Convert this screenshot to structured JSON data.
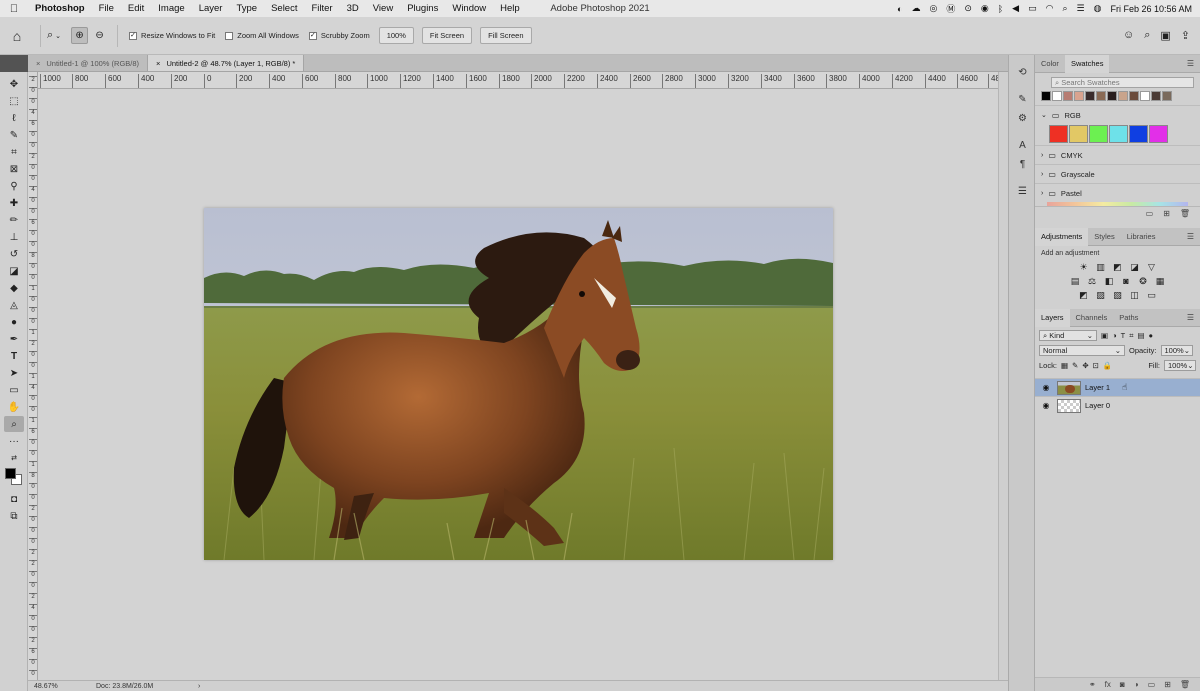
{
  "menubar": {
    "apple_icon": "apple-icon",
    "app": "Photoshop",
    "items": [
      "File",
      "Edit",
      "Image",
      "Layer",
      "Type",
      "Select",
      "Filter",
      "3D",
      "View",
      "Plugins",
      "Window",
      "Help"
    ],
    "window_title": "Adobe Photoshop 2021",
    "datetime": "Fri Feb 26  10:56 AM"
  },
  "options": {
    "resize_windows": "Resize Windows to Fit",
    "zoom_all": "Zoom All Windows",
    "scrubby": "Scrubby Zoom",
    "zoom_value": "100%",
    "fit_screen": "Fit Screen",
    "fill_screen": "Fill Screen"
  },
  "tabs": [
    {
      "label": "Untitled-1 @ 100% (RGB/8)",
      "close": "×"
    },
    {
      "label": "Untitled-2 @ 48.7% (Layer 1, RGB/8) *",
      "close": "×"
    }
  ],
  "ruler": {
    "top": [
      "1000",
      "800",
      "600",
      "400",
      "200",
      "0",
      "200",
      "400",
      "600",
      "800",
      "1000",
      "1200",
      "1400",
      "1600",
      "1800",
      "2000",
      "2200",
      "2400",
      "2600",
      "2800",
      "3000",
      "3200",
      "3400",
      "3600",
      "3800",
      "4000",
      "4200",
      "4400",
      "4600",
      "48"
    ],
    "left": [
      "2",
      "0",
      "0",
      "4",
      "6",
      "0",
      "0",
      "2",
      "0",
      "0",
      "4",
      "0",
      "0",
      "6",
      "0",
      "0",
      "8",
      "0",
      "0",
      "1",
      "0",
      "0",
      "0",
      "1",
      "2",
      "0",
      "0",
      "1",
      "4",
      "0",
      "0",
      "1",
      "6",
      "0",
      "0",
      "1",
      "8",
      "0",
      "0",
      "2",
      "0",
      "0",
      "0",
      "2",
      "2",
      "0",
      "0",
      "2",
      "4",
      "0",
      "0",
      "2",
      "6",
      "0",
      "0"
    ]
  },
  "status": {
    "zoom": "48.67%",
    "doc": "Doc: 23.8M/26.0M",
    "arrow": "›"
  },
  "panels": {
    "color_tab": "Color",
    "swatches_tab": "Swatches",
    "search_placeholder": "Search Swatches",
    "recent_swatches": [
      "#000000",
      "#ffffff",
      "#b77c72",
      "#d9a38f",
      "#3a2c2c",
      "#8a6a55",
      "#2a1e1e",
      "#c9a48c",
      "#6a4a3a",
      "#ffffff",
      "#4a3a34",
      "#7a6a5c"
    ],
    "groups": {
      "rgb": "RGB",
      "cmyk": "CMYK",
      "grayscale": "Grayscale",
      "pastel": "Pastel"
    },
    "rgb_swatches": [
      "#ee3024",
      "#e2c865",
      "#6cf051",
      "#6ee1e9",
      "#0f3fe2",
      "#e22fe8"
    ],
    "adjustments_tab": "Adjustments",
    "styles_tab": "Styles",
    "libraries_tab": "Libraries",
    "add_adjustment": "Add an adjustment",
    "layers_tab": "Layers",
    "channels_tab": "Channels",
    "paths_tab": "Paths",
    "kind": "Kind",
    "blend_mode": "Normal",
    "opacity_label": "Opacity:",
    "opacity_value": "100%",
    "lock_label": "Lock:",
    "fill_label": "Fill:",
    "fill_value": "100%",
    "layers": [
      {
        "name": "Layer 1",
        "active": true
      },
      {
        "name": "Layer 0",
        "active": false
      }
    ]
  }
}
